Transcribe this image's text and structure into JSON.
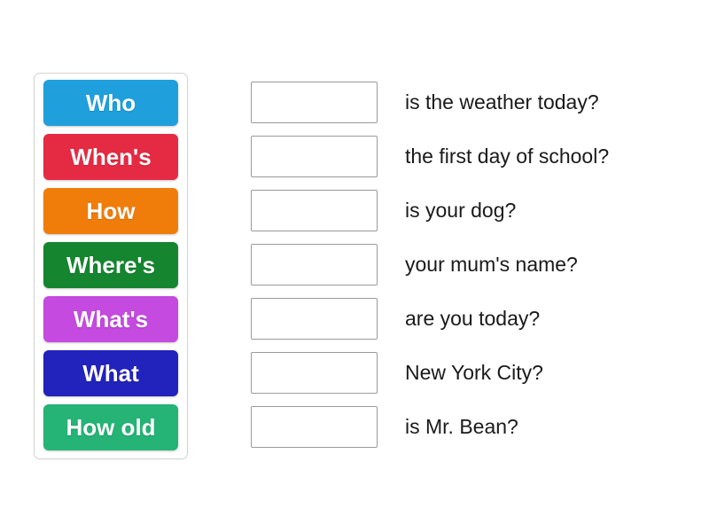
{
  "activity": {
    "name": "question-words-matching",
    "type": "drag-and-drop-match-up"
  },
  "tile_tray": {
    "name": "word-tile-tray",
    "tiles": [
      {
        "label": "Who",
        "color": "#1f9fdb",
        "icon": "word-tile"
      },
      {
        "label": "When's",
        "color": "#e52b43",
        "icon": "word-tile"
      },
      {
        "label": "How",
        "color": "#f07d0a",
        "icon": "word-tile"
      },
      {
        "label": "Where's",
        "color": "#15862f",
        "icon": "word-tile"
      },
      {
        "label": "What's",
        "color": "#c44ae0",
        "icon": "word-tile"
      },
      {
        "label": "What",
        "color": "#2222bd",
        "icon": "word-tile"
      },
      {
        "label": "How old",
        "color": "#25b376",
        "icon": "word-tile"
      }
    ]
  },
  "rows": [
    {
      "dropzone_value": "",
      "dropzone_placeholder": "",
      "question": "is the weather today?"
    },
    {
      "dropzone_value": "",
      "dropzone_placeholder": "",
      "question": "the first day of school?"
    },
    {
      "dropzone_value": "",
      "dropzone_placeholder": "",
      "question": "is your dog?"
    },
    {
      "dropzone_value": "",
      "dropzone_placeholder": "",
      "question": "your mum's name?"
    },
    {
      "dropzone_value": "",
      "dropzone_placeholder": "",
      "question": "are you today?"
    },
    {
      "dropzone_value": "",
      "dropzone_placeholder": "",
      "question": "New York City?"
    },
    {
      "dropzone_value": "",
      "dropzone_placeholder": "",
      "question": "is Mr. Bean?"
    }
  ],
  "colors": {
    "page_background": "#ffffff",
    "tray_border": "#d5d5d5",
    "dropzone_border": "#9a9a9a",
    "question_text": "#1a1a1a",
    "tile_text": "#ffffff"
  }
}
